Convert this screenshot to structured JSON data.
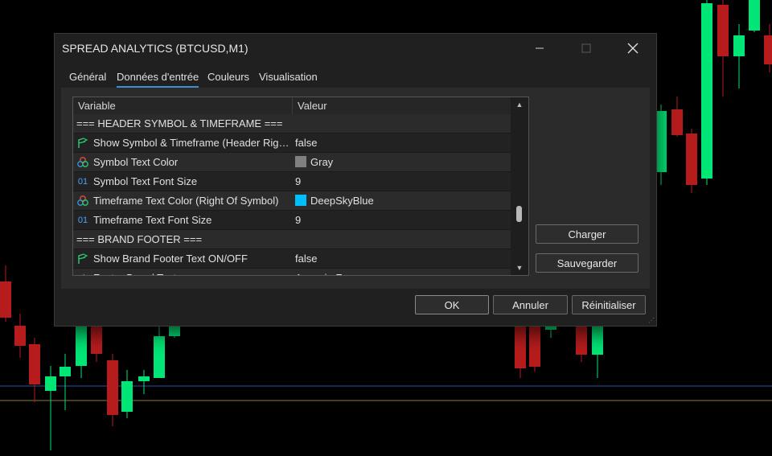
{
  "window": {
    "title": "SPREAD ANALYTICS (BTCUSD,M1)",
    "minimize_icon": "minimize-icon",
    "maximize_icon": "maximize-icon",
    "close_icon": "close-icon"
  },
  "tabs": [
    {
      "label": "Général",
      "active": false
    },
    {
      "label": "Données d'entrée",
      "active": true
    },
    {
      "label": "Couleurs",
      "active": false
    },
    {
      "label": "Visualisation",
      "active": false
    }
  ],
  "table": {
    "col_variable": "Variable",
    "col_value": "Valeur",
    "rows": [
      {
        "icon": "",
        "variable": "=== HEADER SYMBOL & TIMEFRAME ===",
        "value": "",
        "section": true
      },
      {
        "icon": "bool-icon",
        "variable": "Show Symbol & Timeframe (Header Rig…",
        "value": "false"
      },
      {
        "icon": "color-icon",
        "variable": "Symbol Text Color",
        "value": "Gray",
        "swatch": "#808080"
      },
      {
        "icon": "int-icon",
        "variable": "Symbol Text Font Size",
        "value": "9"
      },
      {
        "icon": "color-icon",
        "variable": "Timeframe Text Color (Right Of Symbol)",
        "value": "DeepSkyBlue",
        "swatch": "#00BFFF"
      },
      {
        "icon": "int-icon",
        "variable": "Timeframe Text Font Size",
        "value": "9"
      },
      {
        "icon": "",
        "variable": "=== BRAND FOOTER ===",
        "value": "",
        "section": true
      },
      {
        "icon": "bool-icon",
        "variable": "Show Brand Footer Text ON/OFF",
        "value": "false"
      },
      {
        "icon": "string-icon",
        "variable": "Footer Brand Text",
        "value": "Avaquin Fx"
      }
    ]
  },
  "side_buttons": {
    "load": "Charger",
    "save": "Sauvegarder"
  },
  "footer_buttons": {
    "ok": "OK",
    "cancel": "Annuler",
    "reset": "Réinitialiser"
  },
  "colors": {
    "bull": "#00E676",
    "bear": "#B71C1C",
    "accent": "#3d8fd1"
  }
}
